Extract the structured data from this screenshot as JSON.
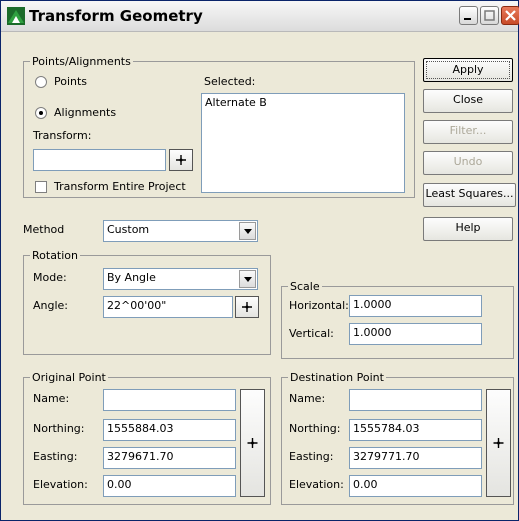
{
  "window": {
    "title": "Transform Geometry"
  },
  "points_alignments": {
    "group_label": "Points/Alignments",
    "points_label": "Points",
    "alignments_label": "Alignments",
    "selected_option": "Alignments",
    "selected_label": "Selected:",
    "selected_items": [
      "Alternate B"
    ],
    "transform_label": "Transform:",
    "transform_value": "",
    "entire_project_label": "Transform Entire Project",
    "entire_project_checked": false
  },
  "buttons": {
    "apply": "Apply",
    "close": "Close",
    "filter": "Filter...",
    "undo": "Undo",
    "least_squares": "Least Squares...",
    "help": "Help"
  },
  "method": {
    "label": "Method",
    "value": "Custom"
  },
  "rotation": {
    "group_label": "Rotation",
    "mode_label": "Mode:",
    "mode_value": "By Angle",
    "angle_label": "Angle:",
    "angle_value": "22^00'00\""
  },
  "scale": {
    "group_label": "Scale",
    "horizontal_label": "Horizontal:",
    "horizontal_value": "1.0000",
    "vertical_label": "Vertical:",
    "vertical_value": "1.0000"
  },
  "original_point": {
    "group_label": "Original Point",
    "name_label": "Name:",
    "name_value": "",
    "northing_label": "Northing:",
    "northing_value": "1555884.03",
    "easting_label": "Easting:",
    "easting_value": "3279671.70",
    "elevation_label": "Elevation:",
    "elevation_value": "0.00"
  },
  "destination_point": {
    "group_label": "Destination Point",
    "name_label": "Name:",
    "name_value": "",
    "northing_label": "Northing:",
    "northing_value": "1555784.03",
    "easting_label": "Easting:",
    "easting_value": "3279771.70",
    "elevation_label": "Elevation:",
    "elevation_value": "0.00"
  },
  "icons": {
    "app": "transform-geometry-icon",
    "pick": "crosshair-pick-icon"
  }
}
